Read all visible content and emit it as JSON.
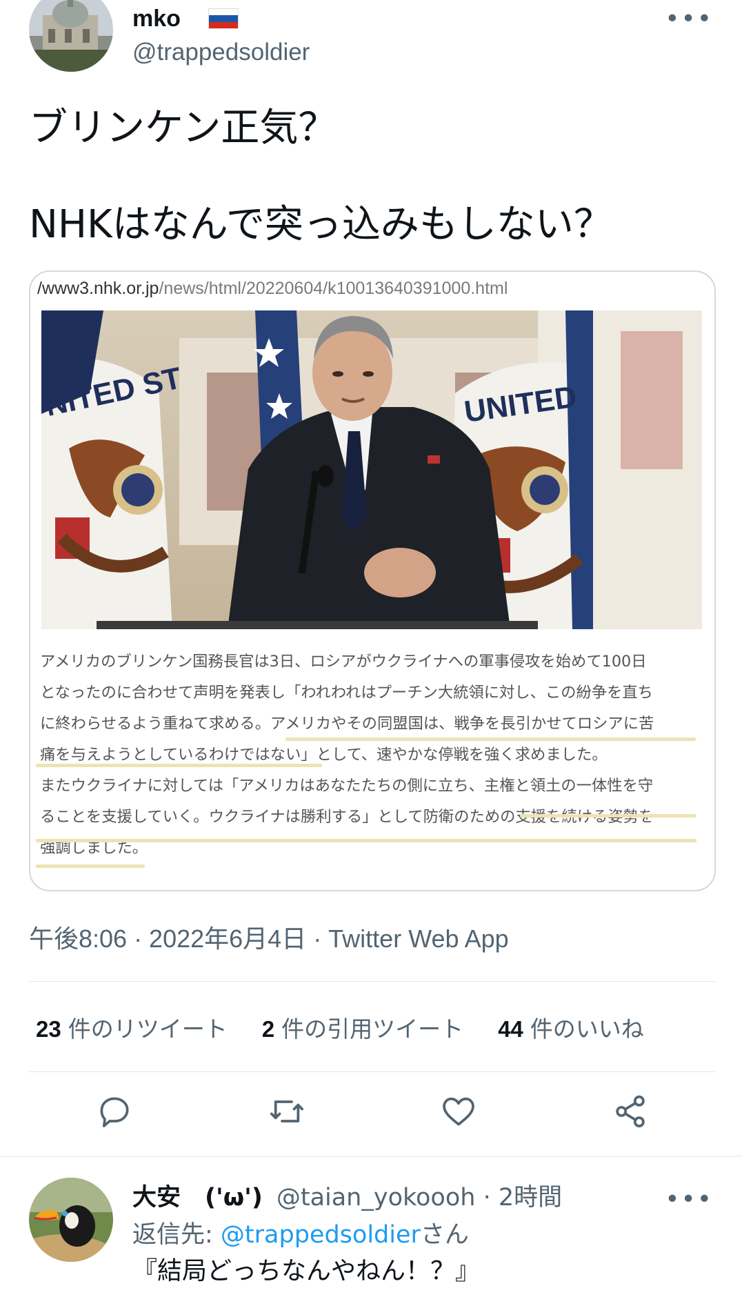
{
  "tweet": {
    "author_name": "mko",
    "author_handle": "@trappedsoldier",
    "text_line1": "ブリンケン正気？",
    "text_line2": "NHKはなんで突っ込みもしない？",
    "timestamp": "午後8:06 · 2022年6月4日 · Twitter Web App"
  },
  "card": {
    "url_domain": "/www3.nhk.or.jp",
    "url_path": "/news/html/20220604/k10013640391000.html",
    "photo_flag_text_left": "NITED ST",
    "photo_flag_text_right": "UNITED",
    "article_lines": [
      "アメリカのブリンケン国務長官は3日、ロシアがウクライナへの軍事侵攻を始めて100日",
      "となったのに合わせて声明を発表し「われわれはプーチン大統領に対し、この紛争を直ち",
      "に終わらせるよう重ねて求める。アメリカやその同盟国は、戦争を長引かせてロシアに苦",
      "痛を与えようとしているわけではない」として、速やかな停戦を強く求めました。",
      "またウクライナに対しては「アメリカはあなたたちの側に立ち、主権と領土の一体性を守",
      "ることを支援していく。ウクライナは勝利する」として防衛のための支援を続ける姿勢を",
      "強調しました。"
    ]
  },
  "stats": {
    "retweets_count": "23",
    "retweets_label": "件のリツイート",
    "quotes_count": "2",
    "quotes_label": "件の引用ツイート",
    "likes_count": "44",
    "likes_label": "件のいいね"
  },
  "actions": {
    "reply": "reply-icon",
    "retweet": "retweet-icon",
    "like": "heart-icon",
    "share": "share-icon"
  },
  "reply": {
    "name": "大安　('ω')",
    "handle_time": "@taian_yokoooh · 2時間",
    "reply_to_prefix": "返信先: ",
    "reply_to_mention": "@trappedsoldier",
    "reply_to_suffix": "さん",
    "text": "『結局どっちなんやねん！？』"
  },
  "colors": {
    "accent": "#1d9bf0",
    "secondary_text": "#536471",
    "highlight": "#ece3b4"
  }
}
